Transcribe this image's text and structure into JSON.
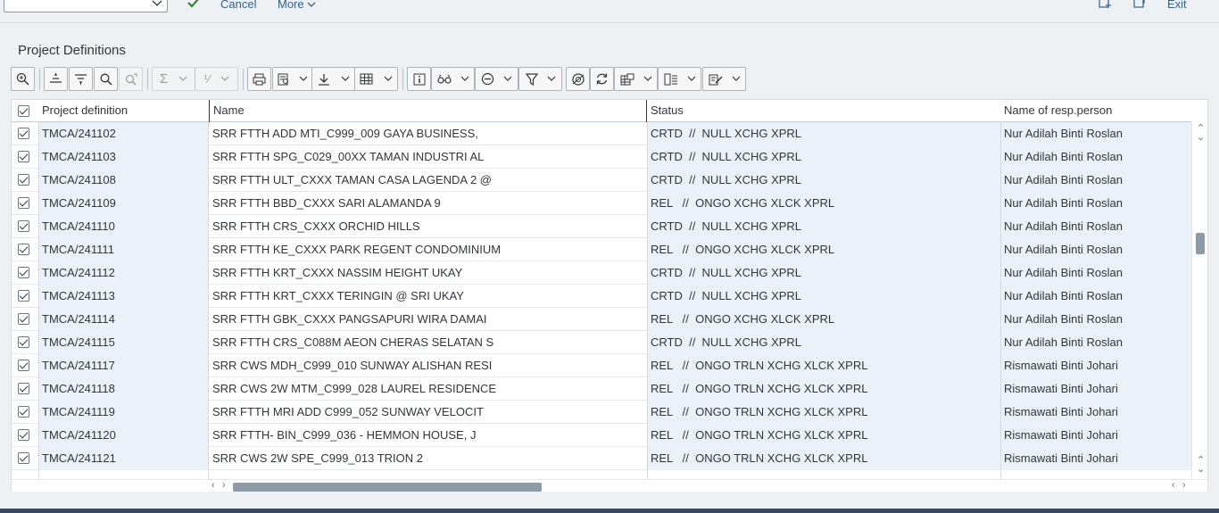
{
  "toolbar": {
    "combo_value": "",
    "confirm_icon": "check-icon",
    "cancel_label": "Cancel",
    "more_label": "More",
    "exit_label": "Exit"
  },
  "page_title": "Project Definitions",
  "alv_toolbar": {
    "buttons": [
      "details",
      "sort-ascending",
      "sort-descending",
      "find",
      "find-next",
      "total",
      "subtotal",
      "print",
      "print-preview",
      "export",
      "layout",
      "info",
      "glasses",
      "minus",
      "filter",
      "views",
      "refresh",
      "layout-settings",
      "column",
      "edit"
    ]
  },
  "columns": {
    "select": "",
    "project_definition": "Project definition",
    "name": "Name",
    "status": "Status",
    "resp_person": "Name of resp.person"
  },
  "rows": [
    {
      "pd": "TMCA/241102",
      "name": "SRR FTTH ADD MTI_C999_009 GAYA BUSINESS,",
      "status": "CRTD  //  NULL XCHG XPRL",
      "person": "Nur Adilah Binti Roslan"
    },
    {
      "pd": "TMCA/241103",
      "name": "SRR FTTH SPG_C029_00XX TAMAN INDUSTRI AL",
      "status": "CRTD  //  NULL XCHG XPRL",
      "person": "Nur Adilah Binti Roslan"
    },
    {
      "pd": "TMCA/241108",
      "name": "SRR FTTH ULT_CXXX TAMAN CASA LAGENDA 2 @",
      "status": "CRTD  //  NULL XCHG XPRL",
      "person": "Nur Adilah Binti Roslan"
    },
    {
      "pd": "TMCA/241109",
      "name": "SRR FTTH BBD_CXXX SARI ALAMANDA 9",
      "status": "REL   //  ONGO XCHG XLCK XPRL",
      "person": "Nur Adilah Binti Roslan"
    },
    {
      "pd": "TMCA/241110",
      "name": "SRR FTTH CRS_CXXX ORCHID HILLS",
      "status": "CRTD  //  NULL XCHG XPRL",
      "person": "Nur Adilah Binti Roslan"
    },
    {
      "pd": "TMCA/241111",
      "name": "SRR FTTH KE_CXXX PARK REGENT CONDOMINIUM",
      "status": "REL   //  ONGO XCHG XLCK XPRL",
      "person": "Nur Adilah Binti Roslan"
    },
    {
      "pd": "TMCA/241112",
      "name": "SRR FTTH KRT_CXXX NASSIM HEIGHT UKAY",
      "status": "CRTD  //  NULL XCHG XPRL",
      "person": "Nur Adilah Binti Roslan"
    },
    {
      "pd": "TMCA/241113",
      "name": "SRR FTTH KRT_CXXX TERINGIN @ SRI UKAY",
      "status": "CRTD  //  NULL XCHG XPRL",
      "person": "Nur Adilah Binti Roslan"
    },
    {
      "pd": "TMCA/241114",
      "name": "SRR FTTH GBK_CXXX PANGSAPURI WIRA DAMAI",
      "status": "REL   //  ONGO XCHG XLCK XPRL",
      "person": "Nur Adilah Binti Roslan"
    },
    {
      "pd": "TMCA/241115",
      "name": "SRR FTTH CRS_C088M AEON CHERAS SELATAN S",
      "status": "CRTD  //  NULL XCHG XPRL",
      "person": "Nur Adilah Binti Roslan"
    },
    {
      "pd": "TMCA/241117",
      "name": "SRR CWS MDH_C999_010 SUNWAY ALISHAN RESI",
      "status": "REL   //  ONGO TRLN XCHG XLCK XPRL",
      "person": "Rismawati Binti Johari"
    },
    {
      "pd": "TMCA/241118",
      "name": "SRR CWS 2W MTM_C999_028 LAUREL RESIDENCE",
      "status": "REL   //  ONGO TRLN XCHG XLCK XPRL",
      "person": "Rismawati Binti Johari"
    },
    {
      "pd": "TMCA/241119",
      "name": "SRR FTTH MRI ADD C999_052 SUNWAY VELOCIT",
      "status": "REL   //  ONGO TRLN XCHG XLCK XPRL",
      "person": "Rismawati Binti Johari"
    },
    {
      "pd": "TMCA/241120",
      "name": "SRR FTTH- BIN_C999_036 - HEMMON HOUSE, J",
      "status": "REL   //  ONGO TRLN XCHG XLCK XPRL",
      "person": "Rismawati Binti Johari"
    },
    {
      "pd": "TMCA/241121",
      "name": "SRR CWS 2W SPE_C999_013 TRION 2",
      "status": "REL   //  ONGO TRLN XCHG XLCK XPRL",
      "person": "Rismawati Binti Johari"
    }
  ]
}
